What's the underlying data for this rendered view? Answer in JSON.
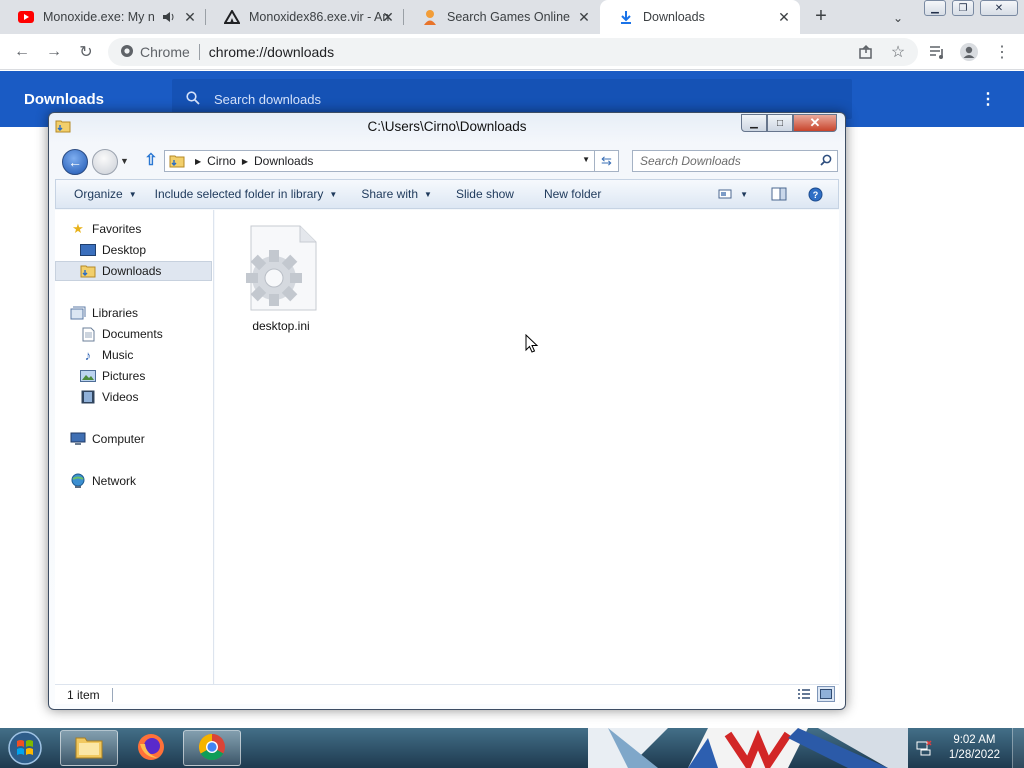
{
  "browser": {
    "tabs": [
      {
        "label": "Monoxide.exe: My ne",
        "icon": "youtube-icon"
      },
      {
        "label": "Monoxidex86.exe.vir - An",
        "icon": "anyrun-icon"
      },
      {
        "label": "Search Games Online",
        "icon": "person-icon"
      },
      {
        "label": "Downloads",
        "icon": "download-icon"
      }
    ],
    "omnibox": {
      "site_label": "Chrome",
      "url": "chrome://downloads"
    }
  },
  "downloads_page": {
    "title": "Downloads",
    "search_placeholder": "Search downloads"
  },
  "explorer": {
    "window_title": "C:\\Users\\Cirno\\Downloads",
    "breadcrumb": [
      "Cirno",
      "Downloads"
    ],
    "search_placeholder": "Search Downloads",
    "commands": [
      {
        "label": "Organize",
        "has_dropdown": true
      },
      {
        "label": "Include selected folder in library",
        "has_dropdown": true
      },
      {
        "label": "Share with",
        "has_dropdown": true
      },
      {
        "label": "Slide show",
        "has_dropdown": false
      },
      {
        "label": "New folder",
        "has_dropdown": false
      }
    ],
    "nav": {
      "favorites_label": "Favorites",
      "desktop_label": "Desktop",
      "downloads_label": "Downloads",
      "libraries_label": "Libraries",
      "documents_label": "Documents",
      "music_label": "Music",
      "pictures_label": "Pictures",
      "videos_label": "Videos",
      "computer_label": "Computer",
      "network_label": "Network"
    },
    "files": [
      {
        "name": "desktop.ini",
        "icon": "settings-file-icon"
      }
    ],
    "status": {
      "item_count": "1 item"
    }
  },
  "taskbar": {
    "time": "9:02 AM",
    "date": "1/28/2022"
  },
  "colors": {
    "chrome_blue": "#1a5bc4",
    "taskbar": "#2a4d66"
  }
}
